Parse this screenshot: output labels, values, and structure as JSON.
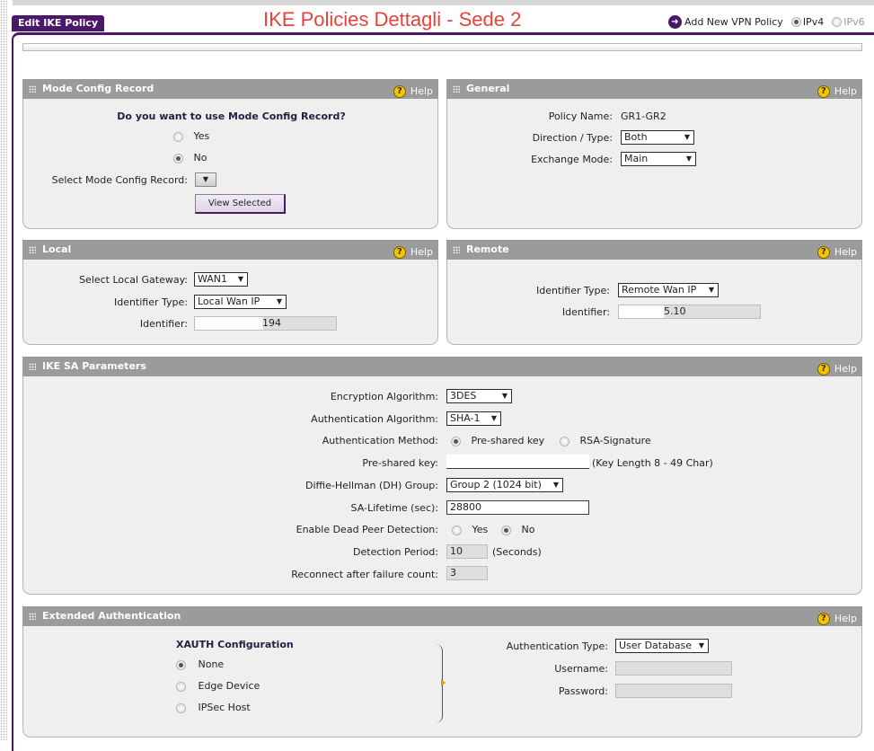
{
  "header": {
    "tab_label": "Edit IKE Policy",
    "page_title": "IKE Policies  Dettagli - Sede 2",
    "add_vpn_label": "Add New VPN Policy",
    "ipv4_label": "IPv4",
    "ipv6_label": "IPv6",
    "ip_selected": "IPv4"
  },
  "help_label": "Help",
  "mode_config": {
    "title": "Mode Config Record",
    "question": "Do you want to use Mode Config Record?",
    "yes_label": "Yes",
    "no_label": "No",
    "selected": "No",
    "select_record_label": "Select Mode Config Record:",
    "view_selected_button": "View Selected"
  },
  "general": {
    "title": "General",
    "policy_name_label": "Policy Name:",
    "policy_name_value": "GR1-GR2",
    "direction_label": "Direction / Type:",
    "direction_value": "Both",
    "exchange_label": "Exchange Mode:",
    "exchange_value": "Main"
  },
  "local": {
    "title": "Local",
    "gateway_label": "Select Local Gateway:",
    "gateway_value": "WAN1",
    "identifier_type_label": "Identifier Type:",
    "identifier_type_value": "Local Wan IP",
    "identifier_label": "Identifier:",
    "identifier_value": "194"
  },
  "remote": {
    "title": "Remote",
    "identifier_type_label": "Identifier Type:",
    "identifier_type_value": "Remote Wan IP",
    "identifier_label": "Identifier:",
    "identifier_value": "5.10"
  },
  "ike_sa": {
    "title": "IKE SA Parameters",
    "encryption_label": "Encryption Algorithm:",
    "encryption_value": "3DES",
    "auth_algo_label": "Authentication Algorithm:",
    "auth_algo_value": "SHA-1",
    "auth_method_label": "Authentication Method:",
    "auth_method_psk": "Pre-shared key",
    "auth_method_rsa": "RSA-Signature",
    "auth_method_selected": "Pre-shared key",
    "psk_label": "Pre-shared key:",
    "psk_value": "",
    "psk_hint": "(Key Length 8 - 49 Char)",
    "dh_label": "Diffie-Hellman (DH) Group:",
    "dh_value": "Group 2 (1024 bit)",
    "lifetime_label": "SA-Lifetime (sec):",
    "lifetime_value": "28800",
    "dpd_label": "Enable Dead Peer Detection:",
    "dpd_yes": "Yes",
    "dpd_no": "No",
    "dpd_selected": "No",
    "detection_label": "Detection Period:",
    "detection_value": "10",
    "detection_unit": "(Seconds)",
    "reconnect_label": "Reconnect after failure count:",
    "reconnect_value": "3"
  },
  "xauth": {
    "title": "Extended Authentication",
    "config_title": "XAUTH Configuration",
    "none_label": "None",
    "edge_label": "Edge Device",
    "ipsec_label": "IPSec Host",
    "selected": "None",
    "auth_type_label": "Authentication Type:",
    "auth_type_value": "User Database",
    "username_label": "Username:",
    "username_value": "",
    "password_label": "Password:",
    "password_value": ""
  }
}
